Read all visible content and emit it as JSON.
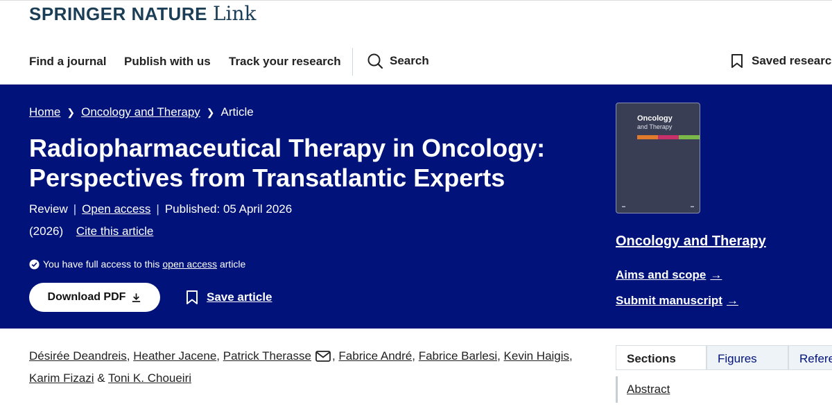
{
  "brand": {
    "name": "SPRINGER NATURE",
    "product": "Link"
  },
  "nav": {
    "find_journal": "Find a journal",
    "publish": "Publish with us",
    "track": "Track your research",
    "search": "Search",
    "saved": "Saved research"
  },
  "breadcrumb": {
    "home": "Home",
    "journal": "Oncology and Therapy",
    "current": "Article"
  },
  "article": {
    "title": "Radiopharmaceutical Therapy in Oncology: Perspectives from Transatlantic Experts",
    "type": "Review",
    "open_access": "Open access",
    "published": "Published: 05 April 2026",
    "year": "(2026)",
    "cite": "Cite this article",
    "access_prefix": "You have full access to this",
    "access_link": "open access",
    "access_suffix": "article",
    "download_label": "Download PDF",
    "save_label": "Save article"
  },
  "journal": {
    "cover_title_line1": "Oncology",
    "cover_title_line2": "and Therapy",
    "cover_stripe_colors": [
      "#e07a2c",
      "#c8306a",
      "#7bb84a"
    ],
    "name": "Oncology and Therapy",
    "aims": "Aims and scope",
    "submit": "Submit manuscript"
  },
  "authors": [
    "Désirée Deandreis",
    "Heather Jacene",
    "Patrick Therasse",
    "Fabrice André",
    "Fabrice Barlesi",
    "Kevin Haigis",
    "Karim Fizazi",
    "Toni K. Choueiri"
  ],
  "authors_separator_last": "&",
  "tabs": {
    "sections": "Sections",
    "figures": "Figures",
    "references": "References"
  },
  "sidebar": {
    "abstract": "Abstract"
  },
  "colors": {
    "hero_bg": "#01137a",
    "brand": "#1b3e56"
  }
}
